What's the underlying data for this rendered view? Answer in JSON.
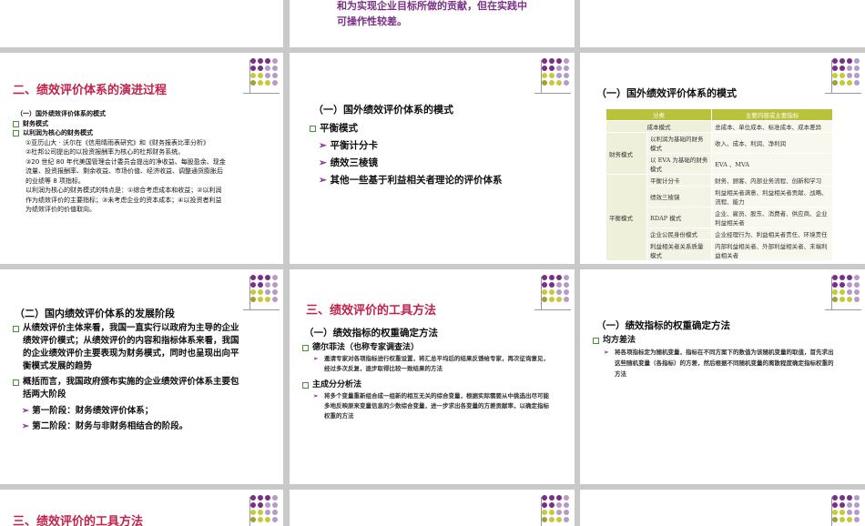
{
  "top_slide": {
    "text_line1": "和为实现企业目标所做的贡献，但在实践中",
    "text_line2": "可操作性较差。"
  },
  "slide_evolution": {
    "title": "二、绩效评价体系的演进过程",
    "sub": "（一）国外绩效评价体系的模式",
    "b1": "财务模式",
    "b2": "以利润为核心的财务模式",
    "p1": "①亚历山大 · 沃尔在《信用晴雨表研究》和《财务报表比率分析》",
    "p2": "②杜邦公司提出的以投资报酬率为核心的杜邦财务系统。",
    "p3": "③20 世纪 80 年代美国管理会计委员会提出的净收益、每股盈余、现金",
    "p4": "流量、投资报酬率、剩余收益、市场价值、经济收益、调整通货膨胀后",
    "p5": "的业绩等 8 项指标。",
    "p6": "以利润为核心的财务模式的特点是：①综合考虑成本和收益；②以利润",
    "p7": "作为绩效评价的主要指标；③未考虑企业的资本成本；④以投资者利益",
    "p8": "为绩效评价的价值取向。"
  },
  "slide_foreign_models": {
    "title": "（一）国外绩效评价体系的模式",
    "b1": "平衡模式",
    "a1": "平衡计分卡",
    "a2": "绩效三棱镜",
    "a3": "其他一些基于利益相关者理论的评价体系"
  },
  "slide_table": {
    "title": "（一）国外绩效评价体系的模式",
    "header_col1": "分类",
    "header_col2": "主要内容或主要指标",
    "r1c1": "成本模式",
    "r1c2": "总成本、单位成本、标准成本、成本差异",
    "g1": "财务模式",
    "r2c1": "以利润为基础的财务模式",
    "r2c2": "收入、成本、利润、净利润",
    "r3c1": "以 EVA 为基础的财务模式",
    "r3c2": "EVA 、MVA",
    "g2": "平衡模式",
    "r4c1": "平衡计分卡",
    "r4c2": "财务、顾客、内部业务流程、创新和学习",
    "r5c1": "绩效三棱镜",
    "r5c2": "利益相关者满意、利益相关者贡献、战略、流程、能力",
    "r6c1": "RDAP 模式",
    "r6c2": "企业、雇员、股东、消费者、供应商、企业利益相关者",
    "r7c1": "企业公民身份模式",
    "r7c2": "企业经理行为、利益相关者责任、环境责任",
    "r8c1": "利益相关者关系质量模式",
    "r8c2": "内部利益相关者、外部利益相关者、末端利益相关者"
  },
  "slide_domestic": {
    "title": "（二）国内绩效评价体系的发展阶段",
    "b1": "从绩效评价主体来看，我国一直实行以政府为主导的企业绩效评价模式；从绩效评价的内容和指标体系来看，我国的企业绩效评价主要表现为财务模式，同时也呈现出向平衡模式发展的趋势",
    "b2": "概括而言，我国政府颁布实施的企业绩效评价体系主要包括两大阶段",
    "a1": "第一阶段：财务绩效评价体系；",
    "a2": "第二阶段：财务与非财务相结合的阶段。"
  },
  "slide_tools": {
    "title": "三、绩效评价的工具方法",
    "sub": "（一）绩效指标的权重确定方法",
    "b1": "德尔菲法（也称专家调查法）",
    "t1": "邀请专家对各项指标进行权重设置，将汇总平均后的结果反馈给专家，再次征询意见，经过多次反复，逐步取得比较一致结果的方法",
    "b2": "主成分分析法",
    "t2": "将多个变量重新组合成一组新的相互无关的综合变量，根据实际需要从中挑选出尽可能多地反映原来变量信息的少数综合变量，进一步求出各变量的方差贡献率，以确定指标权重的方法"
  },
  "slide_variance": {
    "title": "（一）绩效指标的权重确定方法",
    "b1": "均方差法",
    "t1": "将各项指标定为随机变量，指标在不同方案下的数值为该随机变量的取值，首先求出这些随机变量（各指标）的方差，然后根据不同随机变量的离散程度确定指标权重的方法"
  },
  "bottom_slide": {
    "title": "三、绩效评价的工具方法"
  },
  "colors": {
    "title_red": "#c0224b",
    "arrow_purple": "#8b2a9b",
    "bullet_green": "#4b8f3a",
    "dot_purple": "#7a2f86",
    "dot_lavender": "#b59bc6",
    "dot_yellow": "#c8c83a",
    "dot_olive": "#9aa23a"
  }
}
